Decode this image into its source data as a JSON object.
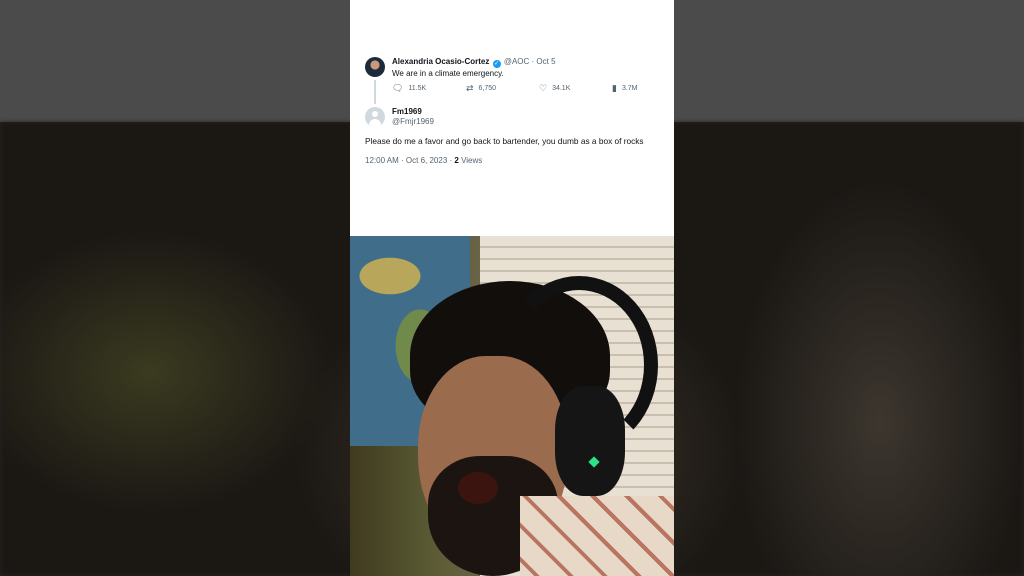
{
  "tweet": {
    "author_name": "Alexandria Ocasio-Cortez",
    "author_handle_date": "@AOC · Oct 5",
    "text": "We are in a climate emergency.",
    "stats": {
      "replies": "11.5K",
      "retweets": "6,750",
      "likes": "34.1K",
      "views": "3.7M"
    }
  },
  "reply": {
    "author_name": "Fm1969",
    "author_handle": "@Fmjr1969",
    "text": "Please do me a favor and go back to bartender, you dumb as a box of rocks",
    "timestamp": "12:00 AM · Oct 6, 2023 · ",
    "views_count": "2",
    "views_label": " Views"
  },
  "icons": {
    "reply": "reply-icon",
    "retweet": "retweet-icon",
    "like": "heart-icon",
    "views": "views-icon",
    "verified": "verified-badge-icon"
  },
  "colors": {
    "accent": "#1d9bf0",
    "text_primary": "#0f1419",
    "text_secondary": "#536471"
  }
}
